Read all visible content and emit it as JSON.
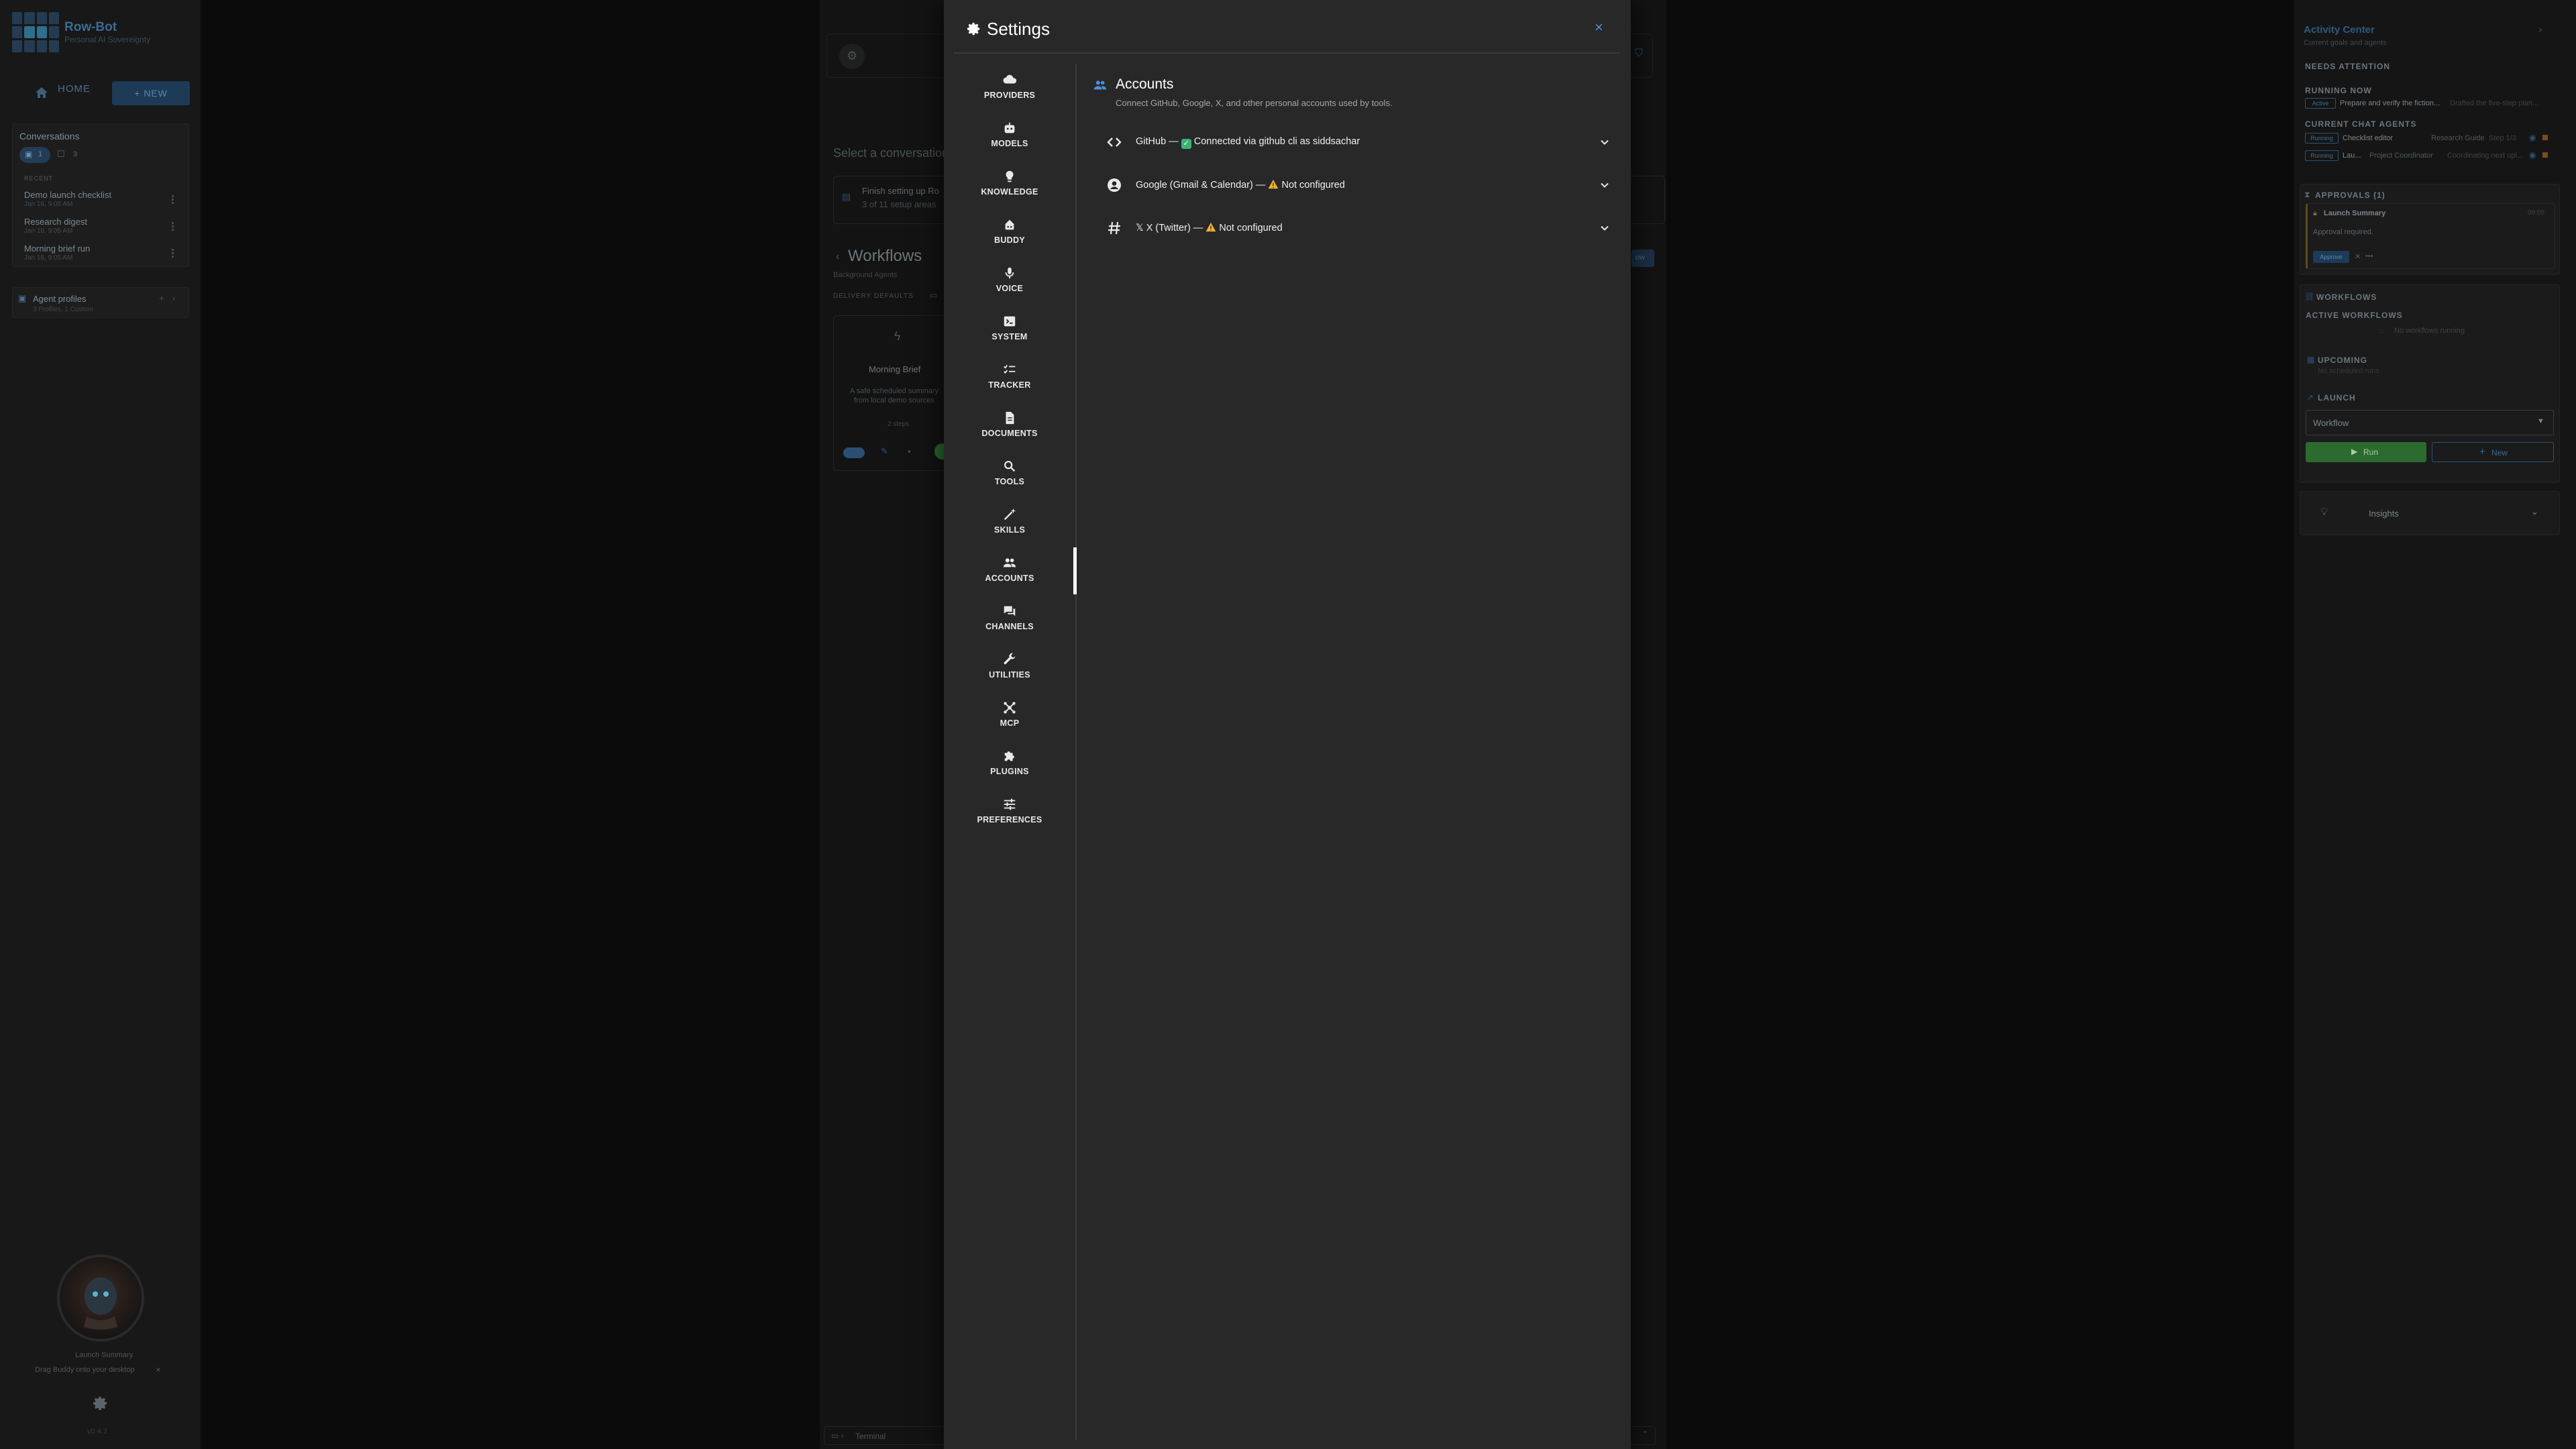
{
  "app": {
    "name": "Row-Bot",
    "tagline": "Personal AI Sovereignty"
  },
  "sidebar": {
    "home_label": "HOME",
    "new_label": "+ NEW",
    "conversations_title": "Conversations",
    "filter_count": "1",
    "chat_count": "3",
    "recent_label": "RECENT",
    "conversations": [
      {
        "title": "Demo launch checklist",
        "date": "Jan 16, 9:05 AM"
      },
      {
        "title": "Research digest",
        "date": "Jan 16, 9:05 AM"
      },
      {
        "title": "Morning brief run",
        "date": "Jan 16, 9:05 AM"
      }
    ],
    "agent_profiles_title": "Agent profiles",
    "agent_profiles_sub": "3 Profiles, 1 Custom",
    "buddy_caption": "Launch Summary",
    "buddy_hint": "Drag Buddy onto your desktop",
    "version": "v0.4.2"
  },
  "center": {
    "select_conversation": "Select a conversation",
    "setup_title": "Finish setting up Ro",
    "setup_sub": "3 of 11 setup areas",
    "workflows_title": "Workflows",
    "workflows_sub": "Background Agents",
    "delivery_defaults": "DELIVERY DEFAULTS",
    "card_title": "Morning Brief",
    "card_desc1": "A safe scheduled summary",
    "card_desc2": "from local demo sources",
    "card_steps": "2 steps",
    "terminal_label": "Terminal"
  },
  "activity": {
    "title": "Activity Center",
    "subtitle": "Current goals and agents",
    "needs_attention": "NEEDS ATTENTION",
    "running_now": "RUNNING NOW",
    "running_badge": "Active",
    "running_task": "Prepare and verify the fiction...",
    "running_detail": "Drafted the five-step plan...",
    "current_chat_agents": "CURRENT CHAT AGENTS",
    "agents": [
      {
        "badge": "Running",
        "name": "Checklist editor",
        "role": "Research Guide",
        "extra": "Step 1/3"
      },
      {
        "badge": "Running",
        "name": "Lau...",
        "role": "Project Coordinator",
        "extra": "Coordinating next upl..."
      }
    ],
    "approvals_title": "APPROVALS (1)",
    "approval_name": "Launch Summary",
    "approval_time": "09:05",
    "approval_text": "Approval required.",
    "approve_label": "Approve",
    "workflows_title": "WORKFLOWS",
    "active_workflows": "ACTIVE WORKFLOWS",
    "no_active": "No workflows running",
    "upcoming_title": "UPCOMING",
    "upcoming_sub": "No scheduled runs",
    "launch_title": "LAUNCH",
    "launch_select": "Workflow",
    "run_label": "Run",
    "new_label": "New",
    "insights_label": "Insights"
  },
  "settings": {
    "title": "Settings",
    "close": "×",
    "nav": [
      {
        "label": "PROVIDERS",
        "icon": "cloud-icon"
      },
      {
        "label": "MODELS",
        "icon": "robot-icon"
      },
      {
        "label": "KNOWLEDGE",
        "icon": "lightbulb-icon"
      },
      {
        "label": "BUDDY",
        "icon": "buddy-icon"
      },
      {
        "label": "VOICE",
        "icon": "microphone-icon"
      },
      {
        "label": "SYSTEM",
        "icon": "terminal-icon"
      },
      {
        "label": "TRACKER",
        "icon": "checklist-icon"
      },
      {
        "label": "DOCUMENTS",
        "icon": "document-icon"
      },
      {
        "label": "TOOLS",
        "icon": "search-icon"
      },
      {
        "label": "SKILLS",
        "icon": "magic-wand-icon"
      },
      {
        "label": "ACCOUNTS",
        "icon": "people-icon"
      },
      {
        "label": "CHANNELS",
        "icon": "chat-icon"
      },
      {
        "label": "UTILITIES",
        "icon": "wrench-icon"
      },
      {
        "label": "MCP",
        "icon": "hub-icon"
      },
      {
        "label": "PLUGINS",
        "icon": "puzzle-icon"
      },
      {
        "label": "PREFERENCES",
        "icon": "sliders-icon"
      }
    ],
    "active_section": "ACCOUNTS",
    "content_title": "Accounts",
    "content_subtitle": "Connect GitHub, Google, X, and other personal accounts used by tools.",
    "accounts": [
      {
        "name": "GitHub — ",
        "status": "Connected via github cli as siddsachar",
        "state": "connected"
      },
      {
        "name": "Google (Gmail & Calendar) — ",
        "status": "Not configured",
        "state": "warning"
      },
      {
        "name": "𝕏 X (Twitter) — ",
        "status": "Not configured",
        "state": "warning"
      }
    ],
    "colors": {
      "accent": "#4a90d9",
      "ok": "#3cb371",
      "warn": "#f2b230"
    }
  }
}
